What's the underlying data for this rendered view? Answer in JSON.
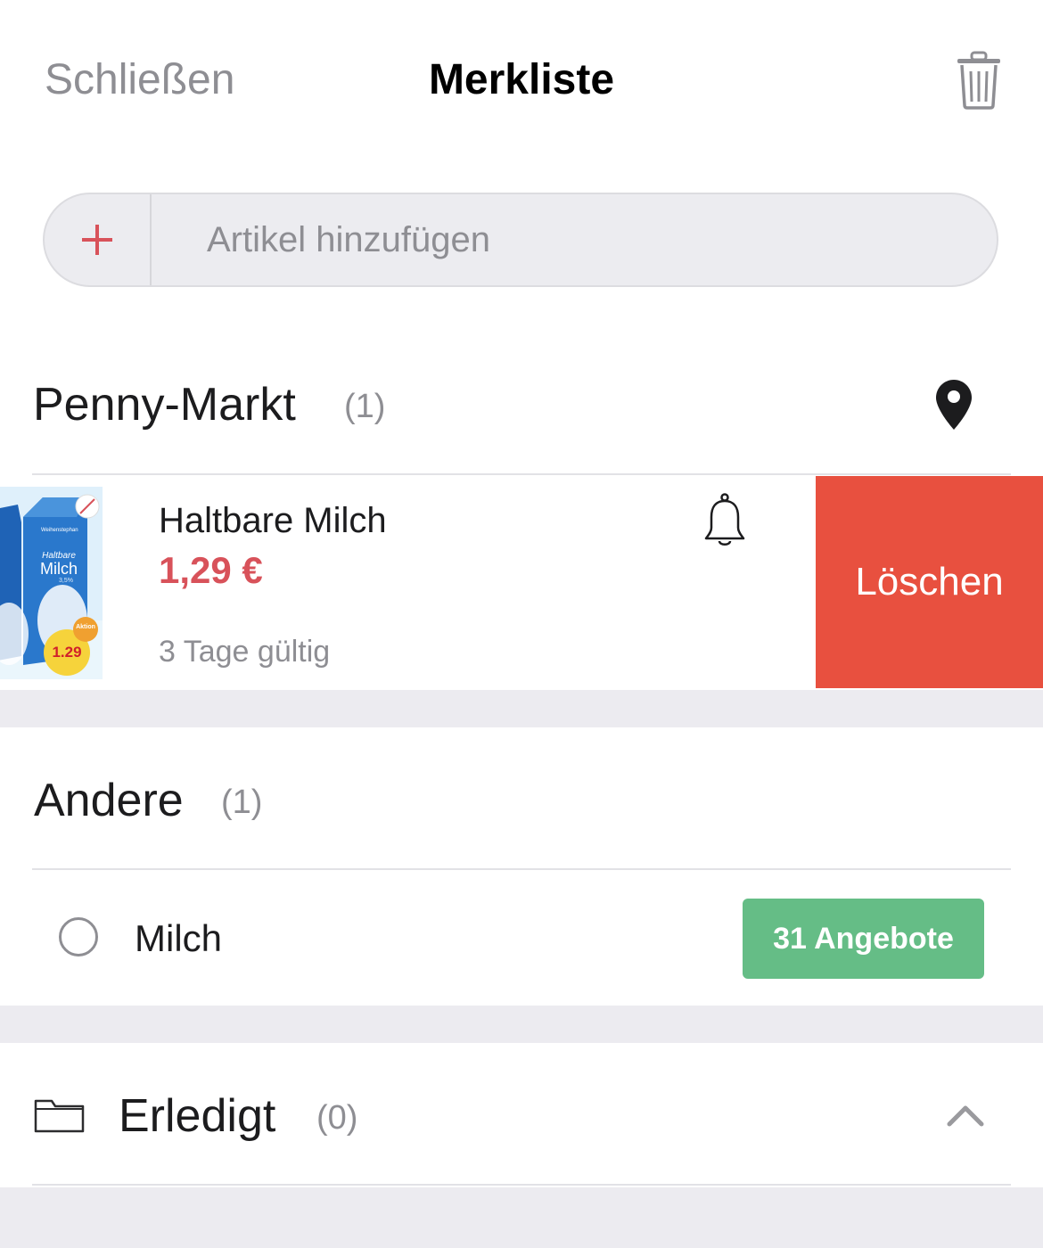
{
  "header": {
    "close_label": "Schließen",
    "title": "Merkliste"
  },
  "add_item": {
    "placeholder": "Artikel hinzufügen"
  },
  "sections": {
    "store": {
      "title": "Penny-Markt",
      "count": "(1)",
      "item": {
        "name": "Haltbare Milch",
        "price": "1,29 €",
        "validity": "3 Tage gültig",
        "image_texts": {
          "brand": "Weihenstephan",
          "product": "Milch",
          "variant": "Haltbare",
          "fat": "3,5%",
          "badge_price": "1.29",
          "badge_label": "Aktion"
        },
        "delete_label": "Löschen"
      }
    },
    "other": {
      "title": "Andere",
      "count": "(1)",
      "item": {
        "name": "Milch",
        "offers_label": "31 Angebote"
      }
    },
    "done": {
      "title": "Erledigt",
      "count": "(0)"
    }
  },
  "colors": {
    "accent_red": "#d8525a",
    "delete_red": "#e8503f",
    "offers_green": "#65bd86",
    "muted_gray": "#8e8e93",
    "background": "#ecebf0"
  },
  "icons": [
    "trash-icon",
    "plus-icon",
    "location-pin-icon",
    "bell-icon",
    "folder-icon",
    "chevron-up-icon"
  ]
}
